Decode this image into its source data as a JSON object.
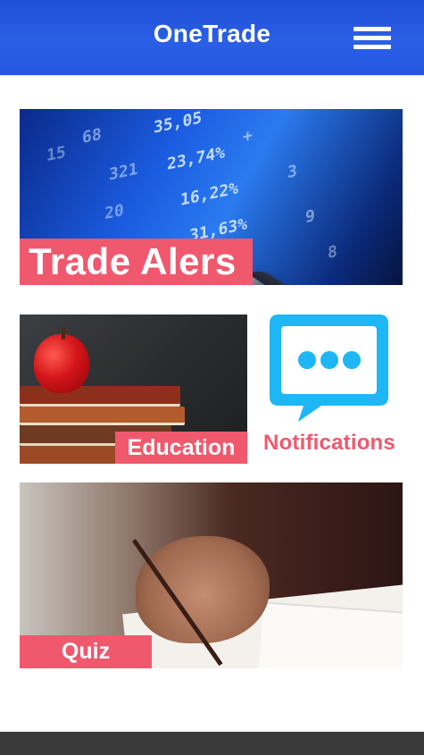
{
  "header": {
    "title": "OneTrade",
    "menu_icon": "hamburger-menu-icon"
  },
  "tiles": {
    "trade_alerts": {
      "label": "Trade Alers"
    },
    "education": {
      "label": "Education"
    },
    "notifications": {
      "label": "Notifications",
      "icon": "chat-bubble-icon"
    },
    "quiz": {
      "label": "Quiz"
    }
  },
  "colors": {
    "header_blue": "#2456e0",
    "accent_pink": "#f0586d",
    "chat_icon_blue": "#1fb6f5",
    "footer_dark": "#3a3a3a"
  }
}
